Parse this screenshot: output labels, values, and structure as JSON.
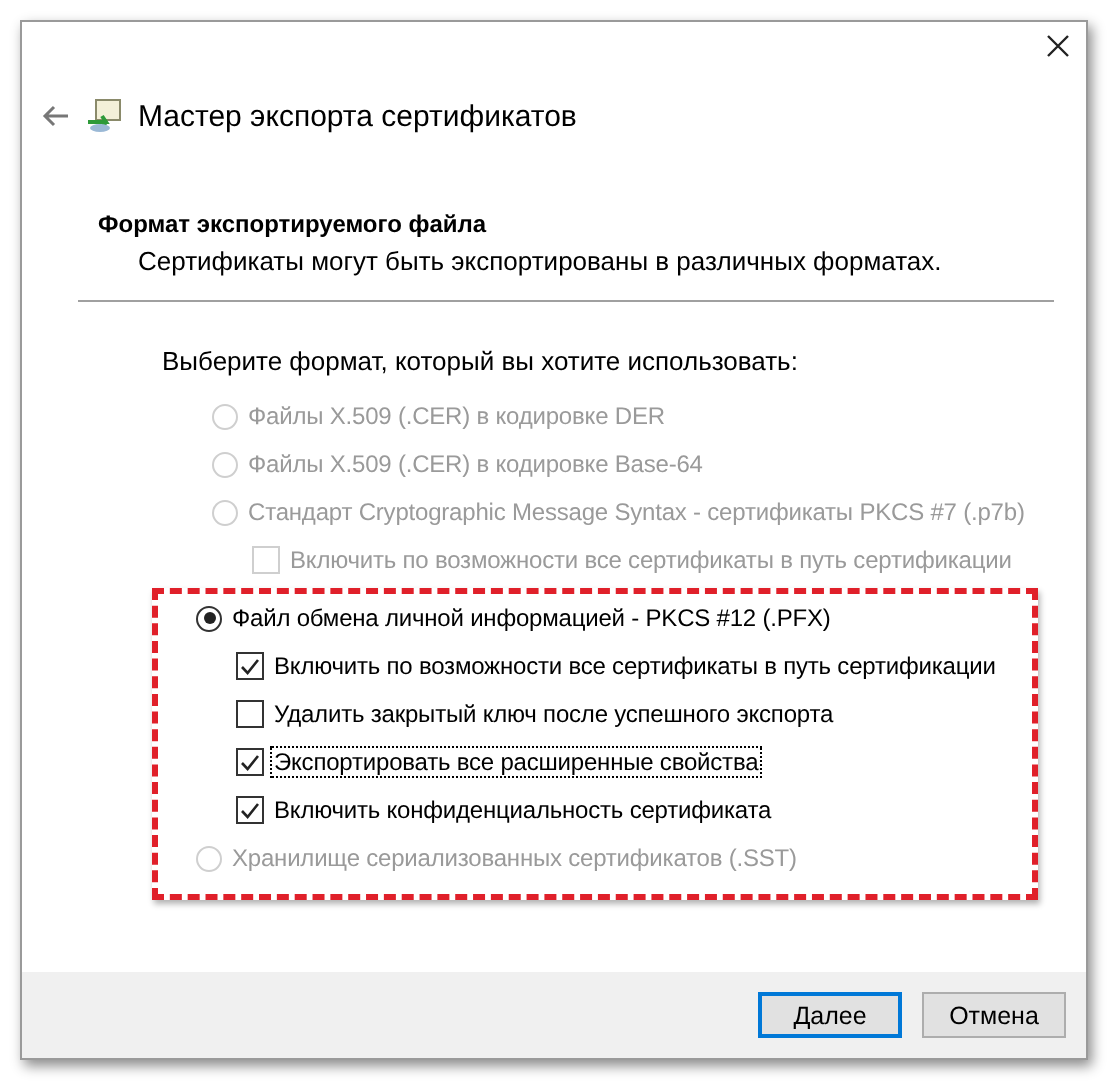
{
  "window": {
    "title": "Мастер экспорта сертификатов"
  },
  "section": {
    "heading": "Формат экспортируемого файла",
    "description": "Сертификаты могут быть экспортированы в различных форматах."
  },
  "prompt": "Выберите формат, который вы хотите использовать:",
  "options": [
    {
      "label": "Файлы X.509 (.CER) в кодировке DER",
      "selected": false,
      "disabled": true,
      "highlighted": false
    },
    {
      "label": "Файлы X.509 (.CER) в кодировке Base-64",
      "selected": false,
      "disabled": true,
      "highlighted": false
    },
    {
      "label": "Стандарт Cryptographic Message Syntax - сертификаты PKCS #7 (.p7b)",
      "selected": false,
      "disabled": true,
      "highlighted": false,
      "children": [
        {
          "label": "Включить по возможности все сертификаты в путь сертификации",
          "checked": false,
          "disabled": true,
          "focused": false
        }
      ]
    },
    {
      "label": "Файл обмена личной информацией - PKCS #12 (.PFX)",
      "selected": true,
      "disabled": false,
      "highlighted": true,
      "children": [
        {
          "label": "Включить по возможности все сертификаты в путь сертификации",
          "checked": true,
          "disabled": false,
          "focused": false
        },
        {
          "label": "Удалить закрытый ключ после успешного экспорта",
          "checked": false,
          "disabled": false,
          "focused": false
        },
        {
          "label": "Экспортировать все расширенные свойства",
          "checked": true,
          "disabled": false,
          "focused": true
        },
        {
          "label": "Включить конфиденциальность сертификата",
          "checked": true,
          "disabled": false,
          "focused": false
        }
      ]
    },
    {
      "label": "Хранилище сериализованных сертификатов (.SST)",
      "selected": false,
      "disabled": true,
      "highlighted": true
    }
  ],
  "buttons": [
    {
      "label": "Далее",
      "default": true
    },
    {
      "label": "Отмена",
      "default": false
    }
  ]
}
